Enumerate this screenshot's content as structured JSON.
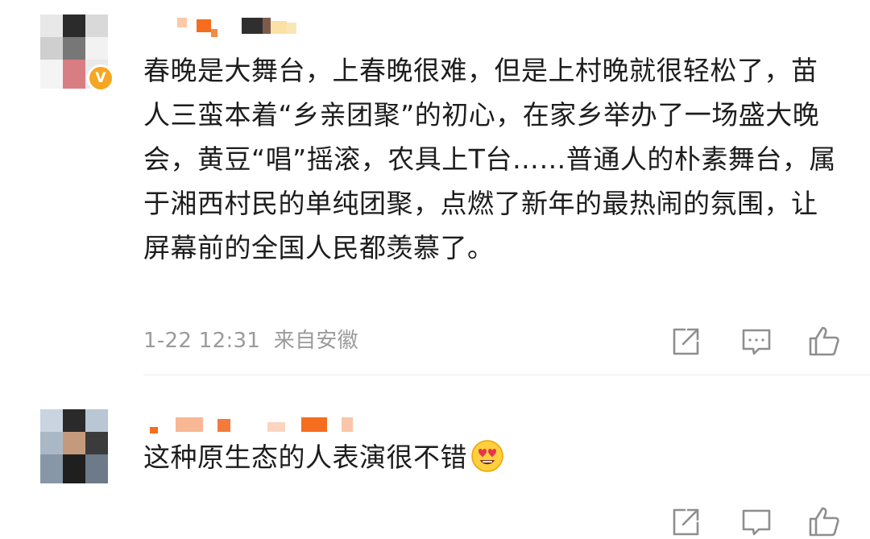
{
  "comments": [
    {
      "text": "春晚是大舞台，上春晚很难，但是上村晚就很轻松了，苗人三蛮本着“乡亲团聚”的初心，在家乡举办了一场盛大晚会，黄豆“唱”摇滚，农具上T台……普通人的朴素舞台，属于湘西村民的单纯团聚，点燃了新年的最热闹的氛围，让屏幕前的全国人民都羡慕了。",
      "time": "1-22 12:31",
      "source": "来自安徽",
      "verified_badge": "V"
    },
    {
      "text": "这种原生态的人表演很不错",
      "emoji": "heart-eyes-emoji"
    }
  ],
  "icons": {
    "share": "share-icon",
    "reply": "comment-icon",
    "like": "thumbs-up-icon"
  },
  "colors": {
    "text": "#1d1d1d",
    "meta": "#9b9b9b",
    "icon": "#8e8e8e",
    "verified": "#f5a623"
  }
}
